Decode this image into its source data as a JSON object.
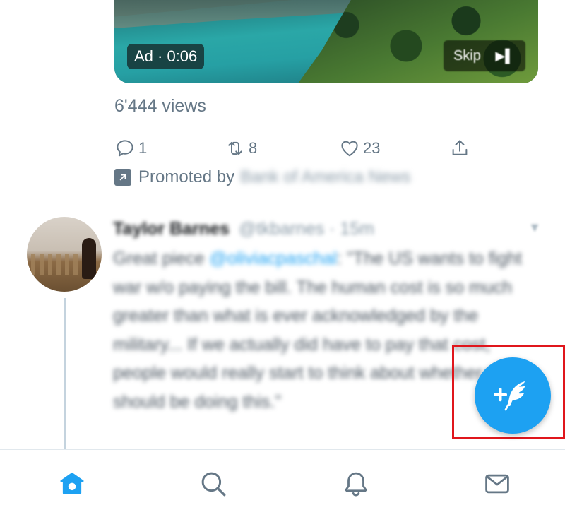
{
  "promoted_tweet": {
    "video": {
      "ad_label": "Ad · 0:06",
      "skip_label": "Skip"
    },
    "views": "6'444 views",
    "actions": {
      "reply_count": "1",
      "retweet_count": "8",
      "like_count": "23"
    },
    "promoted_prefix": "Promoted by",
    "advertiser": "Bank of America News"
  },
  "tweet": {
    "author_name": "Taylor Barnes",
    "author_handle": "@tkbarnes · 15m",
    "text_mention": "@oliviacpaschal",
    "text_before": "Great piece ",
    "text_after": ": \"The US wants to fight war w/o paying the bill. The human cost is so much greater than what is ever acknowledged by the military... If we actually did have to pay that cost, people would really start to think about whether we should be doing this.\""
  },
  "fab": {
    "icon": "compose-tweet-icon"
  },
  "tabbar": {
    "tabs": [
      "home-icon",
      "search-icon",
      "notifications-icon",
      "messages-icon"
    ],
    "active": "home-icon"
  },
  "colors": {
    "accent": "#1da1f2",
    "muted": "#657786",
    "highlight_border": "#e0161c",
    "divider": "#e1e8ed"
  }
}
